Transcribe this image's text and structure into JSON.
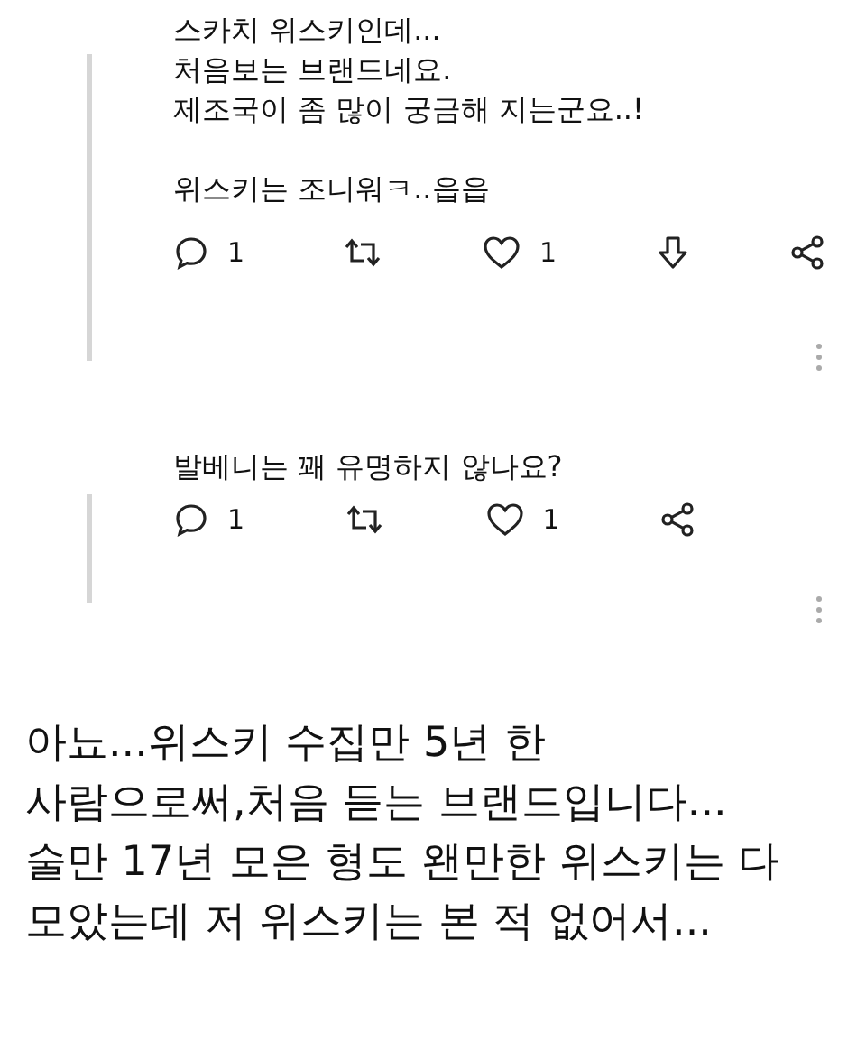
{
  "replies": [
    {
      "paragraphs": [
        [
          "스카치 위스키인데...",
          "처음보는 브랜드네요.",
          "제조국이 좀 많이 궁금해 지는군요..!"
        ],
        [
          "위스키는 조니워ㅋ..읍읍"
        ]
      ],
      "actions": [
        {
          "kind": "comment",
          "count": "1"
        },
        {
          "kind": "retweet"
        },
        {
          "kind": "like",
          "count": "1"
        },
        {
          "kind": "download"
        },
        {
          "kind": "share"
        }
      ]
    },
    {
      "paragraphs": [
        [
          "발베니는 꽤 유명하지 않나요?"
        ]
      ],
      "actions": [
        {
          "kind": "comment",
          "count": "1"
        },
        {
          "kind": "retweet"
        },
        {
          "kind": "like",
          "count": "1"
        },
        {
          "kind": "share"
        }
      ]
    }
  ],
  "caption": [
    "아뇨...위스키 수집만 5년 한",
    "사람으로써,처음 듣는 브랜드입니다...",
    "술만 17년 모은 형도 왠만한 위스키는 다",
    "모았는데 저 위스키는 본 적 없어서..."
  ]
}
